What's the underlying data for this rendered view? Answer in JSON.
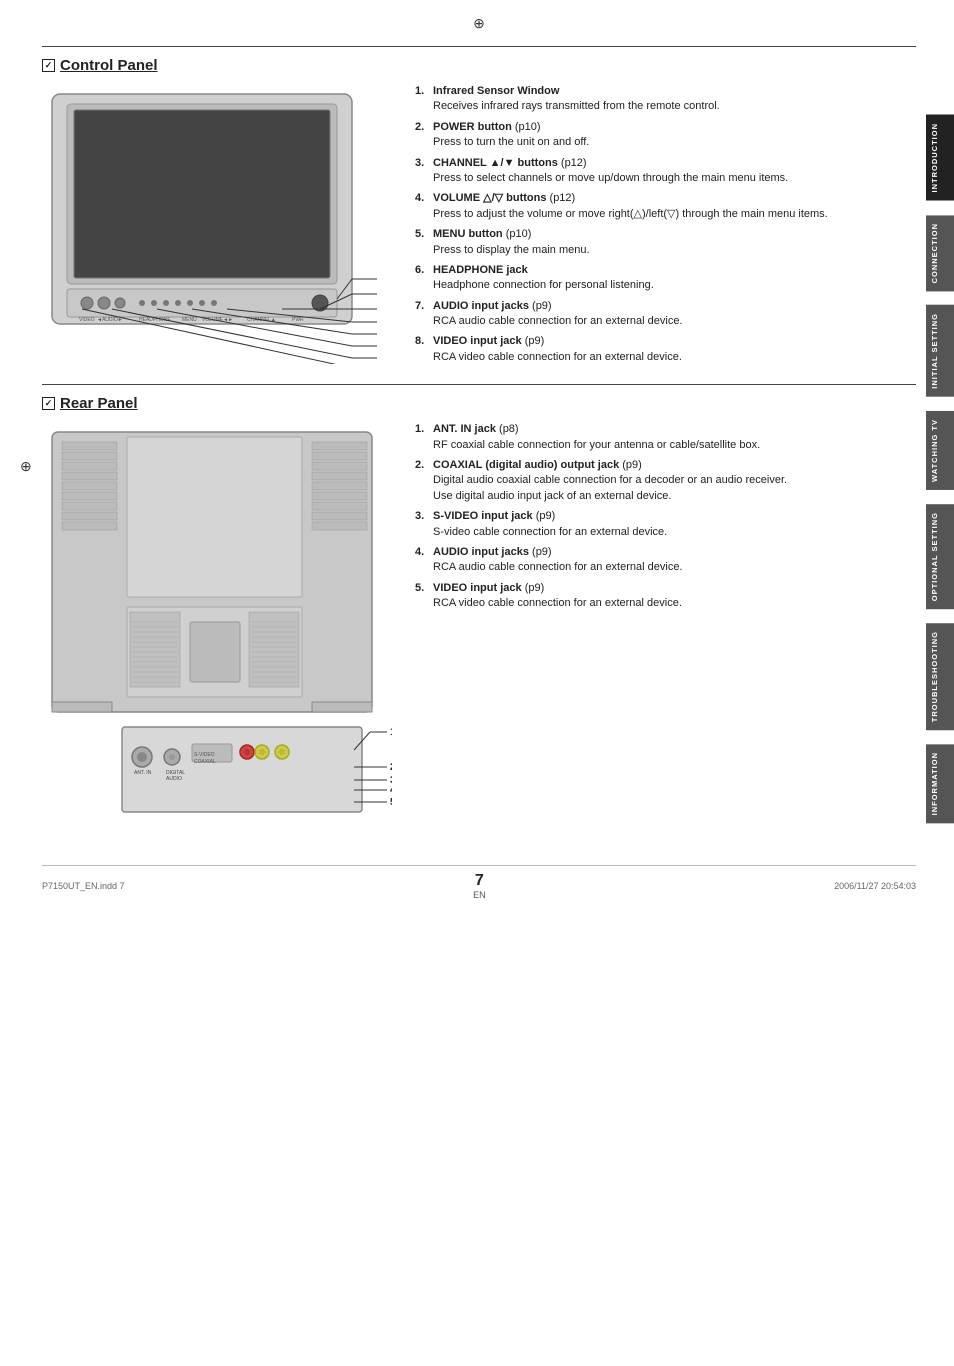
{
  "page": {
    "number": "7",
    "en_label": "EN",
    "footer_left": "P7150UT_EN.indd  7",
    "footer_right": "2006/11/27  20:54:03"
  },
  "side_tabs": [
    {
      "label": "INTRODUCTION",
      "active": true
    },
    {
      "label": "CONNECTION",
      "active": false
    },
    {
      "label": "INITIAL SETTING",
      "active": false
    },
    {
      "label": "WATCHING TV",
      "active": false
    },
    {
      "label": "OPTIONAL SETTING",
      "active": false
    },
    {
      "label": "TROUBLESHOOTING",
      "active": false
    },
    {
      "label": "INFORMATION",
      "active": false
    }
  ],
  "control_panel": {
    "heading": "Control Panel",
    "items": [
      {
        "num": "1",
        "title": "Infrared Sensor Window",
        "ref": "",
        "desc": "Receives infrared rays transmitted from the remote control."
      },
      {
        "num": "2",
        "title": "POWER button",
        "ref": "(p10)",
        "desc": "Press to turn the unit on and off."
      },
      {
        "num": "3",
        "title": "CHANNEL ▲/▼ buttons",
        "ref": "(p12)",
        "desc": "Press to select channels or move up/down through the main menu items."
      },
      {
        "num": "4",
        "title": "VOLUME △/▽ buttons",
        "ref": "(p12)",
        "desc": "Press to adjust the volume or move right(△)/left(▽) through the main menu items."
      },
      {
        "num": "5",
        "title": "MENU button",
        "ref": "(p10)",
        "desc": "Press to display the main menu."
      },
      {
        "num": "6",
        "title": "HEADPHONE jack",
        "ref": "",
        "desc": "Headphone connection for personal listening."
      },
      {
        "num": "7",
        "title": "AUDIO input jacks",
        "ref": "(p9)",
        "desc": "RCA audio cable connection for an external device."
      },
      {
        "num": "8",
        "title": "VIDEO input jack",
        "ref": "(p9)",
        "desc": "RCA video cable connection for an external device."
      }
    ]
  },
  "rear_panel": {
    "heading": "Rear Panel",
    "items": [
      {
        "num": "1",
        "title": "ANT. IN jack",
        "ref": "(p8)",
        "desc": "RF coaxial cable connection for your antenna or cable/satellite box."
      },
      {
        "num": "2",
        "title": "COAXIAL (digital audio) output jack",
        "ref": "(p9)",
        "desc": "Digital audio coaxial cable connection for a decoder or an audio receiver.",
        "desc2": "Use digital audio input jack of an external device."
      },
      {
        "num": "3",
        "title": "S-VIDEO input jack",
        "ref": "(p9)",
        "desc": "S-video cable connection for an external device."
      },
      {
        "num": "4",
        "title": "AUDIO input jacks",
        "ref": "(p9)",
        "desc": "RCA audio cable connection for an external device."
      },
      {
        "num": "5",
        "title": "VIDEO input jack",
        "ref": "(p9)",
        "desc": "RCA video cable connection for an external device."
      }
    ]
  }
}
